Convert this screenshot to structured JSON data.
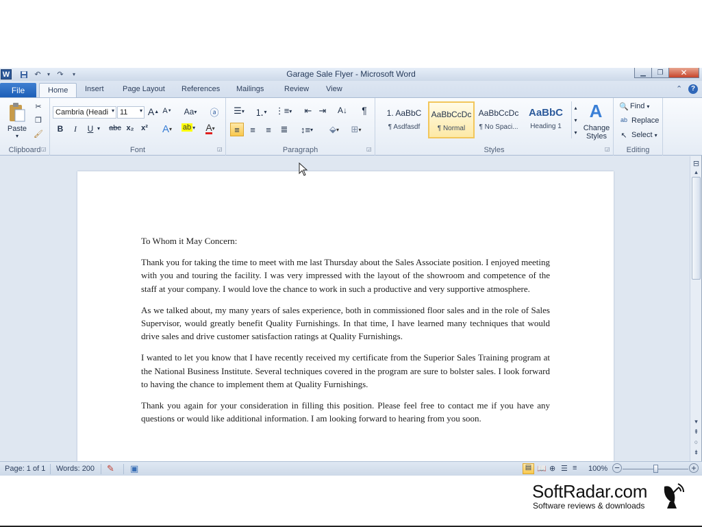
{
  "window": {
    "title": "Garage Sale Flyer - Microsoft Word",
    "app_logo": "W"
  },
  "tabs": {
    "file": "File",
    "items": [
      "Home",
      "Insert",
      "Page Layout",
      "References",
      "Mailings",
      "Review",
      "View"
    ],
    "active": "Home"
  },
  "ribbon": {
    "clipboard": {
      "label": "Clipboard",
      "paste": "Paste"
    },
    "font": {
      "label": "Font",
      "font_name": "Cambria (Headi",
      "font_size": "11",
      "grow": "A",
      "shrink": "A",
      "change_case": "Aa",
      "bold": "B",
      "italic": "I",
      "underline": "U",
      "strike": "abc",
      "subscript": "x₂",
      "superscript": "x²"
    },
    "paragraph": {
      "label": "Paragraph",
      "pilcrow": "¶"
    },
    "styles": {
      "label": "Styles",
      "items": [
        {
          "sample": "1. AaBbC",
          "name": "¶ Asdfasdf"
        },
        {
          "sample": "AaBbCcDc",
          "name": "¶ Normal"
        },
        {
          "sample": "AaBbCcDc",
          "name": "¶ No Spaci..."
        },
        {
          "sample": "AaBbC",
          "name": "Heading 1"
        }
      ],
      "change_styles": "Change Styles"
    },
    "editing": {
      "label": "Editing",
      "find": "Find",
      "replace": "Replace",
      "select": "Select"
    }
  },
  "document": {
    "salutation": "To Whom it May Concern:",
    "paragraphs": [
      "Thank you for taking the time to meet with me last Thursday about the Sales Associate position. I enjoyed meeting with you and touring the facility. I was very impressed with the layout of the showroom and competence of the staff at your company. I would love the chance to work in such a productive and very supportive atmosphere.",
      "As we talked about, my many years of sales experience, both in commissioned floor sales and in the role of Sales Supervisor, would greatly benefit Quality Furnishings. In that time, I have learned many techniques that would drive sales and drive customer satisfaction ratings at Quality Furnishings.",
      "I wanted to let you know that I have recently received my certificate from the Superior Sales Training program at the National Business Institute. Several techniques covered in the program are sure to bolster sales. I look forward to having the chance to implement them at Quality Furnishings.",
      "Thank you again for your consideration in filling this position. Please feel free to contact me if you have any questions or would like additional information. I am looking forward to hearing from you soon."
    ]
  },
  "statusbar": {
    "page": "Page: 1 of 1",
    "words": "Words: 200",
    "zoom": "100%"
  },
  "watermark": {
    "name": "SoftRadar.com",
    "tagline": "Software reviews & downloads"
  },
  "colors": {
    "file_tab": "#2a6ac4",
    "selected_style": "#f2c65a",
    "close_button": "#c6452b"
  }
}
